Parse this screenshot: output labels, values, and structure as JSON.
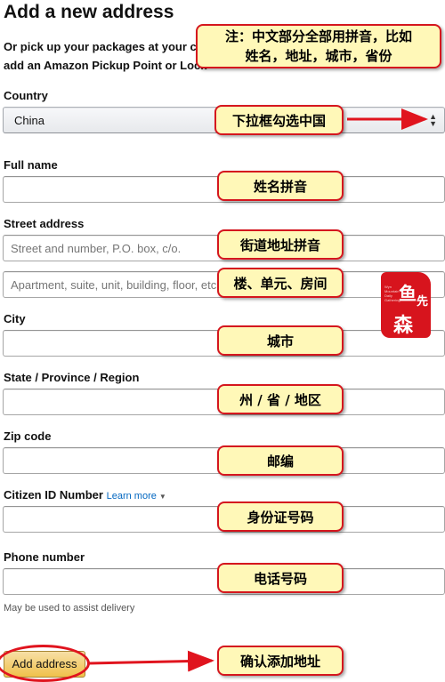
{
  "page": {
    "title": "Add a new address",
    "subtitle": "Or pick up your packages at your co\nadd an Amazon Pickup Point or Lock"
  },
  "form": {
    "country": {
      "label": "Country",
      "value": "China",
      "arrow": "▲\n▼"
    },
    "full_name": {
      "label": "Full name",
      "value": ""
    },
    "street": {
      "label": "Street address",
      "line1_placeholder": "Street and number, P.O. box, c/o.",
      "line2_placeholder": "Apartment, suite, unit, building, floor, etc."
    },
    "city": {
      "label": "City",
      "value": ""
    },
    "state": {
      "label": "State / Province / Region",
      "value": ""
    },
    "zip": {
      "label": "Zip code",
      "value": ""
    },
    "citizen_id": {
      "label": "Citizen ID Number",
      "learn_more": "Learn more"
    },
    "phone": {
      "label": "Phone number",
      "value": "",
      "hint": "May be used to assist delivery"
    },
    "submit_label": "Add address"
  },
  "annotations": {
    "note": "注：中文部分全部用拼音，比如\n姓名，地址，城市，省份",
    "country": "下拉框勾选中国",
    "name": "姓名拼音",
    "street": "街道地址拼音",
    "building": "楼、单元、房间",
    "city": "城市",
    "state": "州 / 省 / 地区",
    "zip": "邮编",
    "id": "身份证号码",
    "phone": "电话号码",
    "submit": "确认添加地址"
  },
  "stamp": {
    "text": "鱼先森",
    "subtext": "Wyn Mountain Daily Gathering"
  },
  "colors": {
    "accent_red": "#d5161e",
    "callout_fill": "#fff8b8",
    "link": "#0066c0",
    "button_gold": "#f0c14b"
  }
}
